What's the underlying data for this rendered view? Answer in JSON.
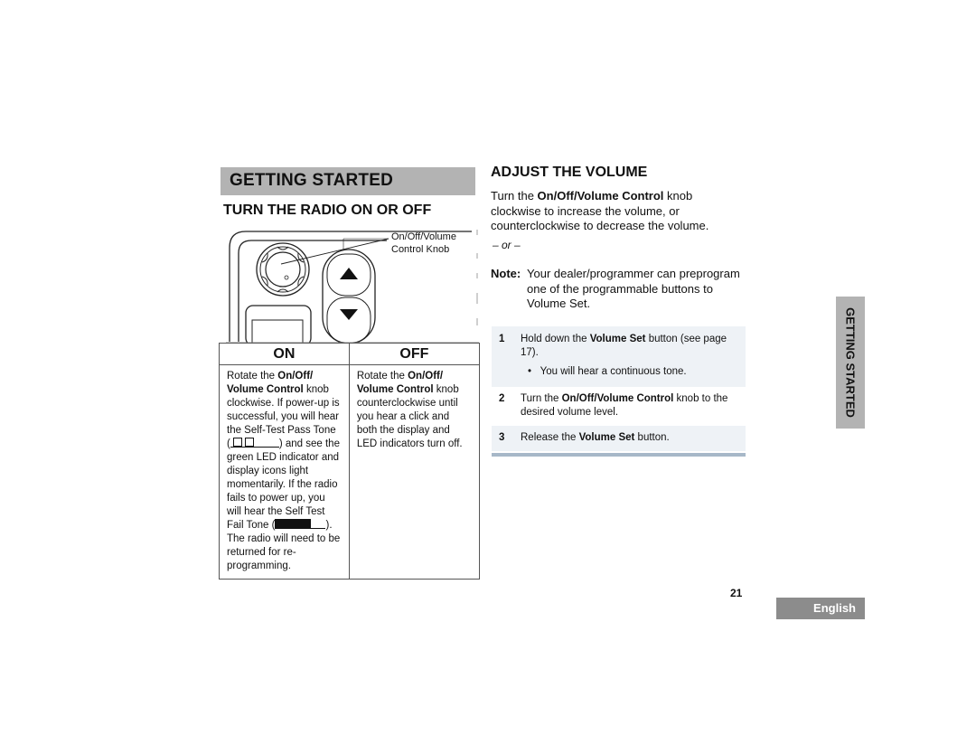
{
  "left": {
    "section_title": "GETTING STARTED",
    "heading": "TURN THE RADIO ON OR OFF",
    "illustration": {
      "callout_line1": "On/Off/Volume",
      "callout_line2": "Control Knob",
      "icons": [
        "volume-knob-icon",
        "arrow-up-button-icon",
        "arrow-down-button-icon",
        "display-icon"
      ]
    },
    "table": {
      "headers": [
        "ON",
        "OFF"
      ],
      "on": {
        "t1": "Rotate the ",
        "b1": "On/Off/ Volume Control",
        "t2": " knob clockwise. If power-up is successful, you will hear the Self-Test Pass Tone (",
        "t3": ") and see the green LED indicator and display icons light momentarily. If the radio fails to power up, you will hear the Self Test Fail Tone (",
        "t4": "). The radio will need to be returned for re-programming."
      },
      "off": {
        "t1": "Rotate the ",
        "b1": "On/Off/ Volume Control",
        "t2": " knob counterclockwise until you hear a click and both the display and LED indicators turn off."
      }
    }
  },
  "right": {
    "heading": "ADJUST THE VOLUME",
    "intro": {
      "t1": "Turn the ",
      "b1": "On/Off/Volume Control",
      "t2": " knob clockwise to increase the volume, or counterclockwise to decrease the volume."
    },
    "or": "– or –",
    "note": {
      "label": "Note:",
      "text": "Your dealer/programmer can preprogram one of the programmable buttons to Volume Set."
    },
    "steps": [
      {
        "num": "1",
        "t1": "Hold down the ",
        "b1": "Volume Set",
        "t2": " button (see page 17).",
        "bullet": "You will hear a continuous tone."
      },
      {
        "num": "2",
        "t1": "Turn the ",
        "b1": "On/Off/Volume Control",
        "t2": " knob to the desired volume level."
      },
      {
        "num": "3",
        "t1": "Release the ",
        "b1": "Volume Set",
        "t2": " button."
      }
    ]
  },
  "side_tab": "GETTING STARTED",
  "page_number": "21",
  "language_tab": "English",
  "colors": {
    "section_bar": "#b3b3b3",
    "language_tab": "#8c8c8c",
    "step_shade": "#eef2f6",
    "rule": "#a7b8c8"
  }
}
